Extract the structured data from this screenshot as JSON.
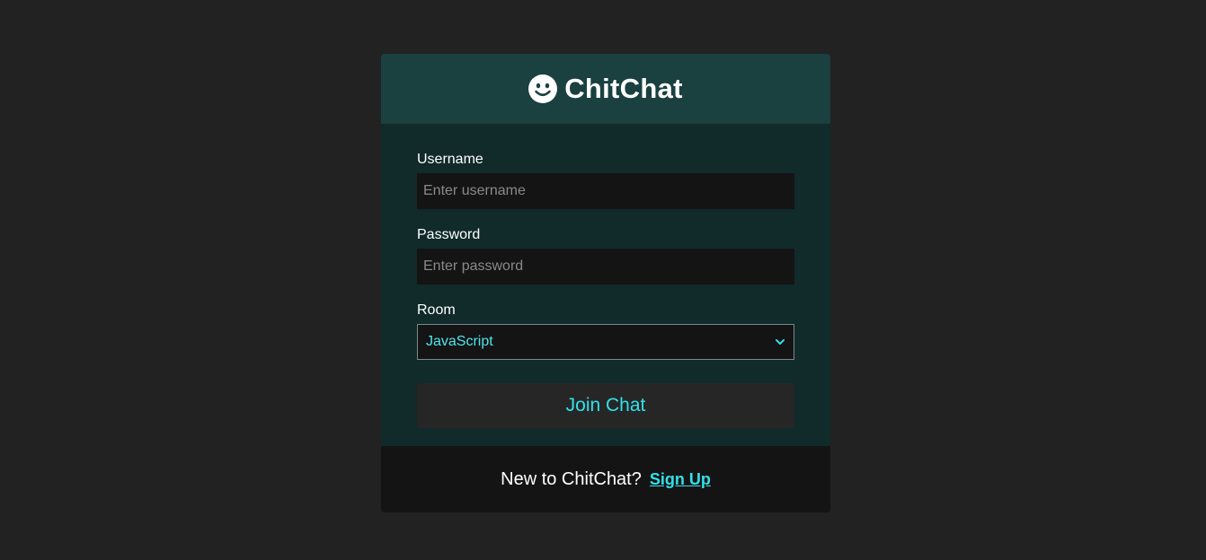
{
  "app": {
    "name": "ChitChat",
    "logo_icon": "smiley-icon"
  },
  "form": {
    "username": {
      "label": "Username",
      "value": "",
      "placeholder": "Enter username"
    },
    "password": {
      "label": "Password",
      "value": "",
      "placeholder": "Enter password"
    },
    "room": {
      "label": "Room",
      "selected": "JavaScript"
    },
    "submit_label": "Join Chat"
  },
  "footer": {
    "prompt": "New to ChitChat?",
    "link_label": "Sign Up"
  },
  "colors": {
    "page_background": "#222222",
    "header_background": "#1a4040",
    "body_background": "#112a2a",
    "footer_background": "#141414",
    "accent": "#33e0ea"
  }
}
